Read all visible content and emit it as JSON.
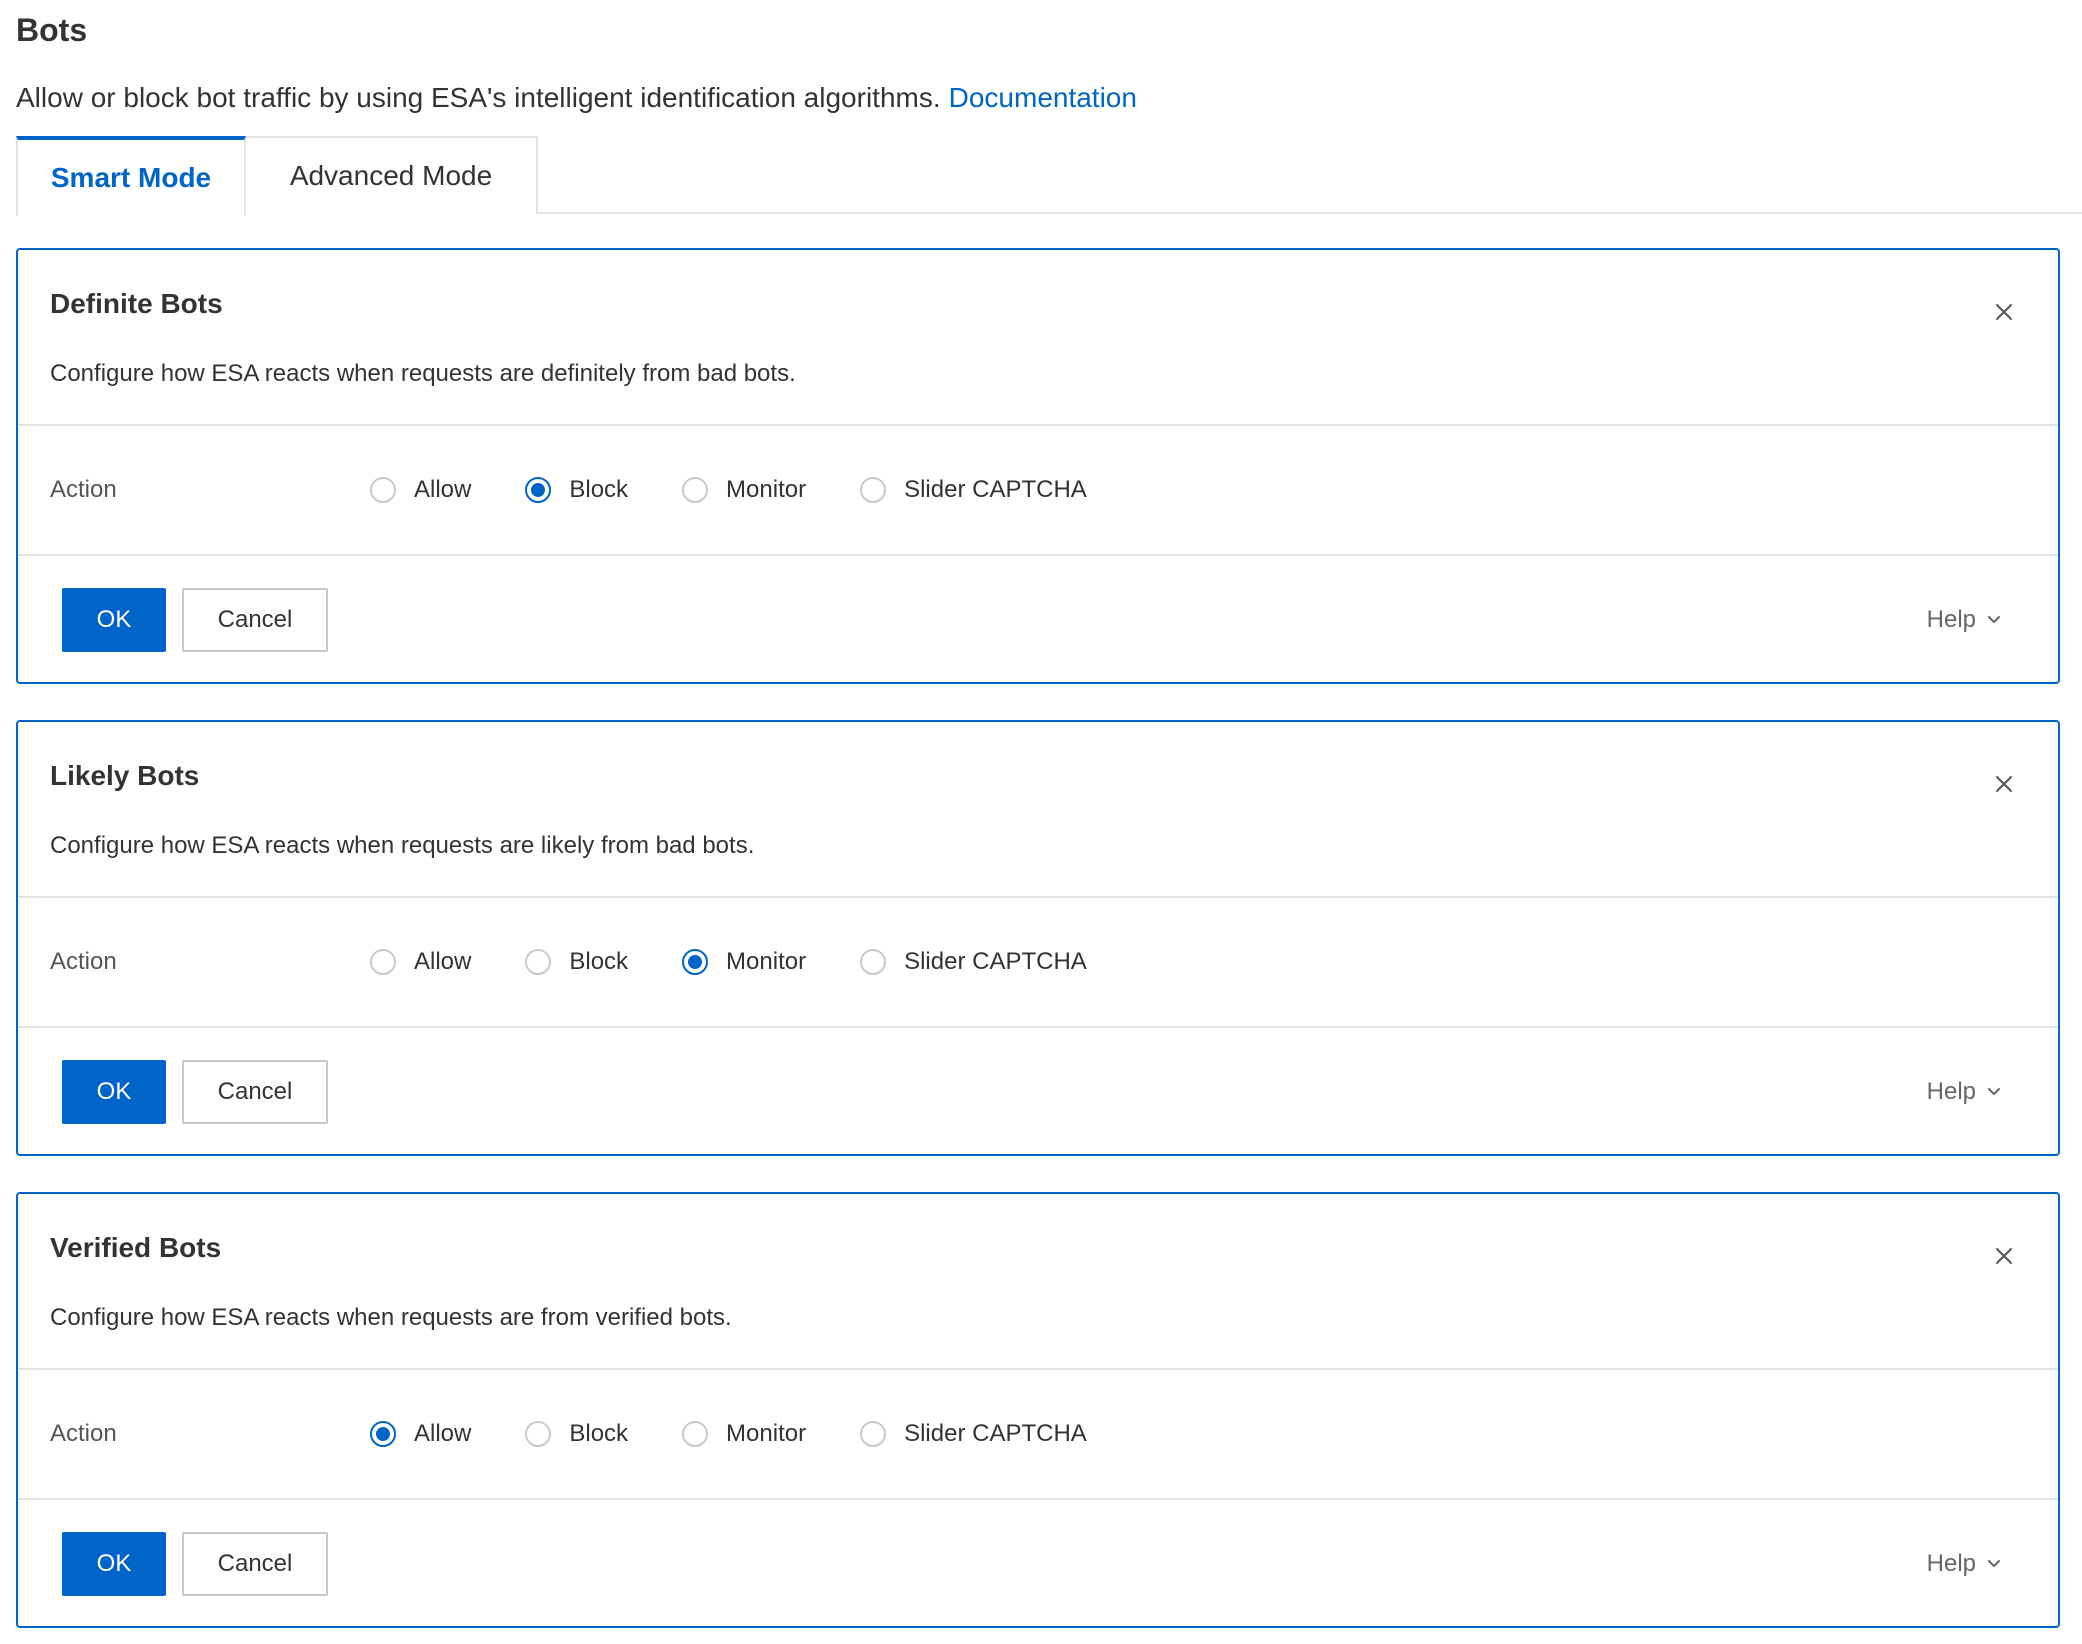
{
  "page": {
    "title": "Bots",
    "description": "Allow or block bot traffic by using ESA's intelligent identification algorithms.",
    "doc_link": "Documentation"
  },
  "tabs": [
    {
      "label": "Smart Mode",
      "active": true
    },
    {
      "label": "Advanced Mode",
      "active": false
    }
  ],
  "cards": [
    {
      "title": "Definite Bots",
      "description": "Configure how ESA reacts when requests are definitely from bad bots.",
      "action_label": "Action",
      "options": [
        "Allow",
        "Block",
        "Monitor",
        "Slider CAPTCHA"
      ],
      "selected": "Block",
      "ok_label": "OK",
      "cancel_label": "Cancel",
      "help_label": "Help"
    },
    {
      "title": "Likely Bots",
      "description": "Configure how ESA reacts when requests are likely from bad bots.",
      "action_label": "Action",
      "options": [
        "Allow",
        "Block",
        "Monitor",
        "Slider CAPTCHA"
      ],
      "selected": "Monitor",
      "ok_label": "OK",
      "cancel_label": "Cancel",
      "help_label": "Help"
    },
    {
      "title": "Verified Bots",
      "description": "Configure how ESA reacts when requests are from verified bots.",
      "action_label": "Action",
      "options": [
        "Allow",
        "Block",
        "Monitor",
        "Slider CAPTCHA"
      ],
      "selected": "Allow",
      "ok_label": "OK",
      "cancel_label": "Cancel",
      "help_label": "Help"
    }
  ],
  "colors": {
    "primary": "#0064c8",
    "border": "#e3e3e3",
    "text": "#333333"
  }
}
